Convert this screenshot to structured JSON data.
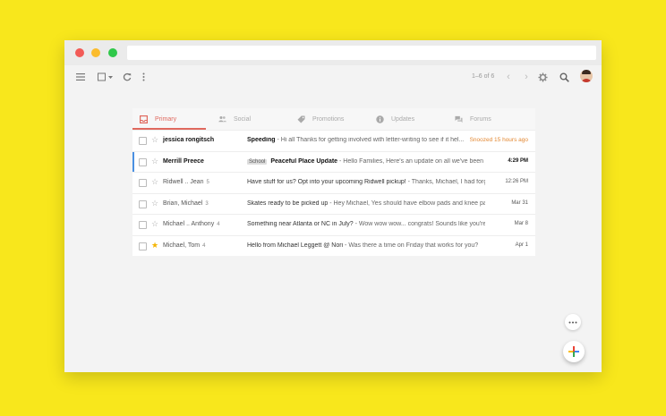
{
  "toolbar": {
    "page_count": "1–6 of 6",
    "prev_icon": "‹",
    "next_icon": "›"
  },
  "tabs": [
    {
      "label": "Primary",
      "icon": "inbox-icon"
    },
    {
      "label": "Social",
      "icon": "people-icon"
    },
    {
      "label": "Promotions",
      "icon": "tag-icon"
    },
    {
      "label": "Updates",
      "icon": "info-icon"
    },
    {
      "label": "Forums",
      "icon": "forum-icon"
    }
  ],
  "colors": {
    "background": "#f8e71c",
    "accent": "#e0695e",
    "snoozed": "#e38833",
    "star": "#f4b400",
    "selection": "#4a90e2"
  },
  "emails": [
    {
      "sender": "jessica rongitsch",
      "count": "",
      "label": "",
      "subject": "Speeding",
      "snippet": " - Hi all Thanks for getting involved with letter-writing to see if it hel...",
      "date": "Snoozed 15 hours ago",
      "starred": false,
      "unread": true
    },
    {
      "sender": "Merrill Preece",
      "count": "",
      "label": "School",
      "subject": "Peaceful Place Update",
      "snippet": " - Hello Families, Here's an update on all we've been up to...",
      "date": "4:29 PM",
      "starred": false,
      "unread": true
    },
    {
      "sender": "Ridwell .. Jean",
      "count": "5",
      "label": "",
      "subject": "Have stuff for us? Opt into your upcoming Ridwell pickup!",
      "snippet": " - Thanks, Michael, I had forgot...",
      "date": "12:26 PM",
      "starred": false,
      "unread": false
    },
    {
      "sender": "Brian, Michael",
      "count": "3",
      "label": "",
      "subject": "Skates ready to be picked up",
      "snippet": " - Hey Michael, Yes should have elbow pads and knee pads, ...",
      "date": "Mar 31",
      "starred": false,
      "unread": false
    },
    {
      "sender": "Michael .. Anthony",
      "count": "4",
      "label": "",
      "subject": "Something near Atlanta or NC in July?",
      "snippet": " - Wow wow wow... congrats! Sounds like you're pl...",
      "date": "Mar 8",
      "starred": false,
      "unread": false
    },
    {
      "sender": "Michael, Tom",
      "count": "4",
      "label": "",
      "subject": "Hello from Michael Leggett @ Nori",
      "snippet": " - Was there a time on Friday that works for you?",
      "date": "Apr 1",
      "starred": true,
      "unread": false
    }
  ]
}
